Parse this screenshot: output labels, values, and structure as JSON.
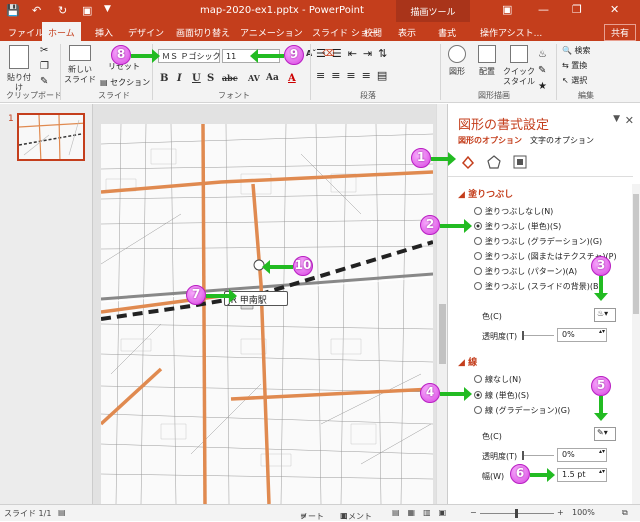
{
  "window": {
    "title": "map-2020-ex1.pptx - PowerPoint",
    "context_tab": "描画ツール",
    "share": "共有"
  },
  "tabs": [
    "ファイル",
    "ホーム",
    "挿入",
    "デザイン",
    "画面切り替え",
    "アニメーション",
    "スライド ショー",
    "校閲",
    "表示",
    "書式",
    "操作アシスト..."
  ],
  "ribbon": {
    "clipboard": {
      "paste": "貼り付け",
      "group": "クリップボード"
    },
    "slides": {
      "new_slide": "新しい スライド",
      "reset": "リセット",
      "section": "セクション",
      "group": "スライド"
    },
    "font": {
      "name": "ＭＳ Ｐゴシック",
      "size": "11",
      "group": "フォント",
      "bold": "B",
      "italic": "I",
      "underline": "U",
      "strike": "S",
      "shadow": "abc",
      "case": "Aa",
      "color": "A"
    },
    "paragraph": {
      "group": "段落"
    },
    "drawing": {
      "shape": "図形",
      "arrange": "配置",
      "quick_style": "クイック スタイル",
      "group": "図形描画"
    },
    "edit": {
      "find": "検索",
      "replace": "置換",
      "select": "選択",
      "group": "編集"
    }
  },
  "slide_panel": {
    "slide_number": "1"
  },
  "map": {
    "station_label": "JR 甲南駅"
  },
  "pane": {
    "title": "図形の書式設定",
    "tab_shape": "図形のオプション",
    "tab_text": "文字のオプション",
    "fill": {
      "header": "塗りつぶし",
      "options": [
        "塗りつぶしなし(N)",
        "塗りつぶし (単色)(S)",
        "塗りつぶし (グラデーション)(G)",
        "塗りつぶし (図またはテクスチャ)(P)",
        "塗りつぶし (パターン)(A)",
        "塗りつぶし (スライドの背景)(B)"
      ],
      "selected": 1,
      "color_label": "色(C)",
      "trans_label": "透明度(T)",
      "trans_value": "0%"
    },
    "line": {
      "header": "線",
      "options": [
        "線なし(N)",
        "線 (単色)(S)",
        "線 (グラデーション)(G)"
      ],
      "selected": 1,
      "color_label": "色(C)",
      "trans_label": "透明度(T)",
      "trans_value": "0%",
      "width_label": "幅(W)",
      "width_value": "1.5 pt"
    }
  },
  "status": {
    "slide": "スライド 1/1",
    "notes": "ノート",
    "comments": "コメント",
    "zoom": "100%"
  },
  "callouts": [
    "1",
    "2",
    "3",
    "4",
    "5",
    "6",
    "7",
    "8",
    "9",
    "10"
  ],
  "colors": {
    "accent": "#c43e1c",
    "callout": "#d640e0",
    "arrow": "#22bb22",
    "road": "#e08a50"
  }
}
